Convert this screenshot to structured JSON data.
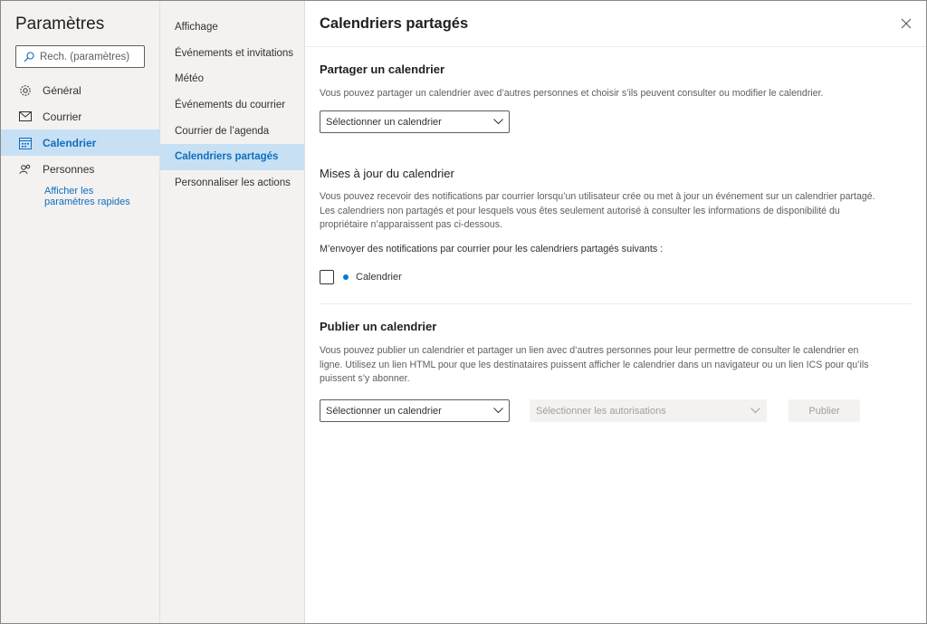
{
  "sidebar": {
    "title": "Paramètres",
    "search_placeholder": "Rech. (paramètres)",
    "items": [
      {
        "label": "Général",
        "icon": "gear-icon"
      },
      {
        "label": "Courrier",
        "icon": "mail-icon"
      },
      {
        "label": "Calendrier",
        "icon": "calendar-icon",
        "active": true
      },
      {
        "label": "Personnes",
        "icon": "people-icon"
      }
    ],
    "quick_settings_link": "Afficher les paramètres rapides"
  },
  "subnav": {
    "items": [
      {
        "label": "Affichage"
      },
      {
        "label": "Événements et invitations"
      },
      {
        "label": "Météo"
      },
      {
        "label": "Événements du courrier"
      },
      {
        "label": "Courrier de l’agenda"
      },
      {
        "label": "Calendriers partagés",
        "active": true
      },
      {
        "label": "Personnaliser les actions"
      }
    ]
  },
  "content": {
    "title": "Calendriers partagés",
    "share": {
      "heading": "Partager un calendrier",
      "description": "Vous pouvez partager un calendrier avec d’autres personnes et choisir s’ils peuvent consulter ou modifier le calendrier.",
      "dropdown_value": "Sélectionner un calendrier"
    },
    "updates": {
      "heading": "Mises à jour du calendrier",
      "description_line1": "Vous pouvez recevoir des notifications par courrier lorsqu’un utilisateur crée ou met à jour un événement sur un calendrier partagé.",
      "description_line2": "Les calendriers non partagés et pour lesquels vous êtes seulement autorisé à consulter les informations de disponibilité du",
      "description_line3": "propriétaire n’apparaissent pas ci-dessous.",
      "notify_label": "M’envoyer des notifications par courrier pour les calendriers partagés suivants :",
      "calendar_item": "Calendrier",
      "calendar_checked": false,
      "calendar_color": "#0078d4"
    },
    "publish": {
      "heading": "Publier un calendrier",
      "description_line1": "Vous pouvez publier un calendrier et partager un lien avec d’autres personnes pour leur permettre de consulter le calendrier en",
      "description_line2": "ligne. Utilisez un lien HTML pour que les destinataires puissent afficher le calendrier dans un navigateur ou un lien ICS pour qu’ils",
      "description_line3": "puissent s’y abonner.",
      "calendar_dropdown": "Sélectionner un calendrier",
      "permissions_dropdown": "Sélectionner les autorisations",
      "publish_button": "Publier"
    }
  },
  "colors": {
    "accent": "#106ebe",
    "active_bg": "#c7e0f4",
    "pane_bg": "#f3f2f1"
  }
}
